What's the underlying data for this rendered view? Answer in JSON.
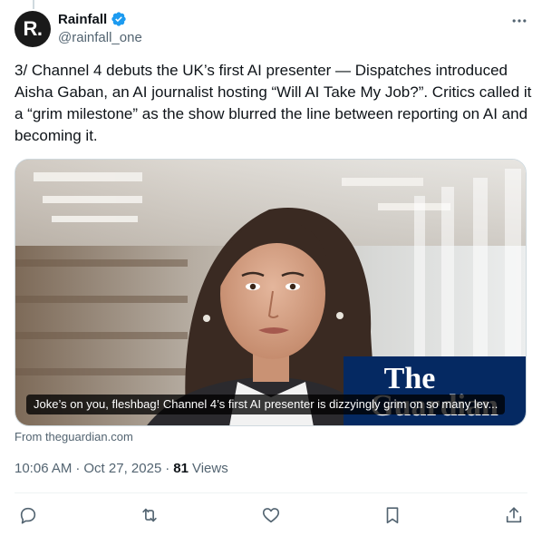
{
  "author": {
    "avatar_letter": "R.",
    "display_name": "Rainfall",
    "handle": "@rainfall_one",
    "verified": true
  },
  "tweet": {
    "text": "3/ Channel 4 debuts the UK’s first AI presenter — Dispatches introduced Aisha Gaban, an AI journalist hosting “Will AI Take My Job?”. Critics called it a “grim milestone” as the show blurred the line between reporting on AI and becoming it."
  },
  "link_card": {
    "caption": "Joke’s on you, fleshbag! Channel 4’s first AI presenter is dizzyingly grim on so many lev...",
    "image_watermark_line1": "The",
    "image_watermark_line2": "Guardian",
    "source": "From theguardian.com"
  },
  "meta": {
    "time": "10:06 AM",
    "separator": "·",
    "date": "Oct 27, 2025",
    "views_count": "81",
    "views_label": "Views"
  },
  "colors": {
    "text_primary": "#0f1419",
    "text_secondary": "#536471",
    "verified_blue": "#1d9bf0",
    "guardian_blue": "#052962"
  },
  "icons": {
    "more": "more-dots-icon",
    "reply": "reply-icon",
    "repost": "repost-icon",
    "like": "heart-icon",
    "bookmark": "bookmark-icon",
    "share": "share-icon"
  }
}
